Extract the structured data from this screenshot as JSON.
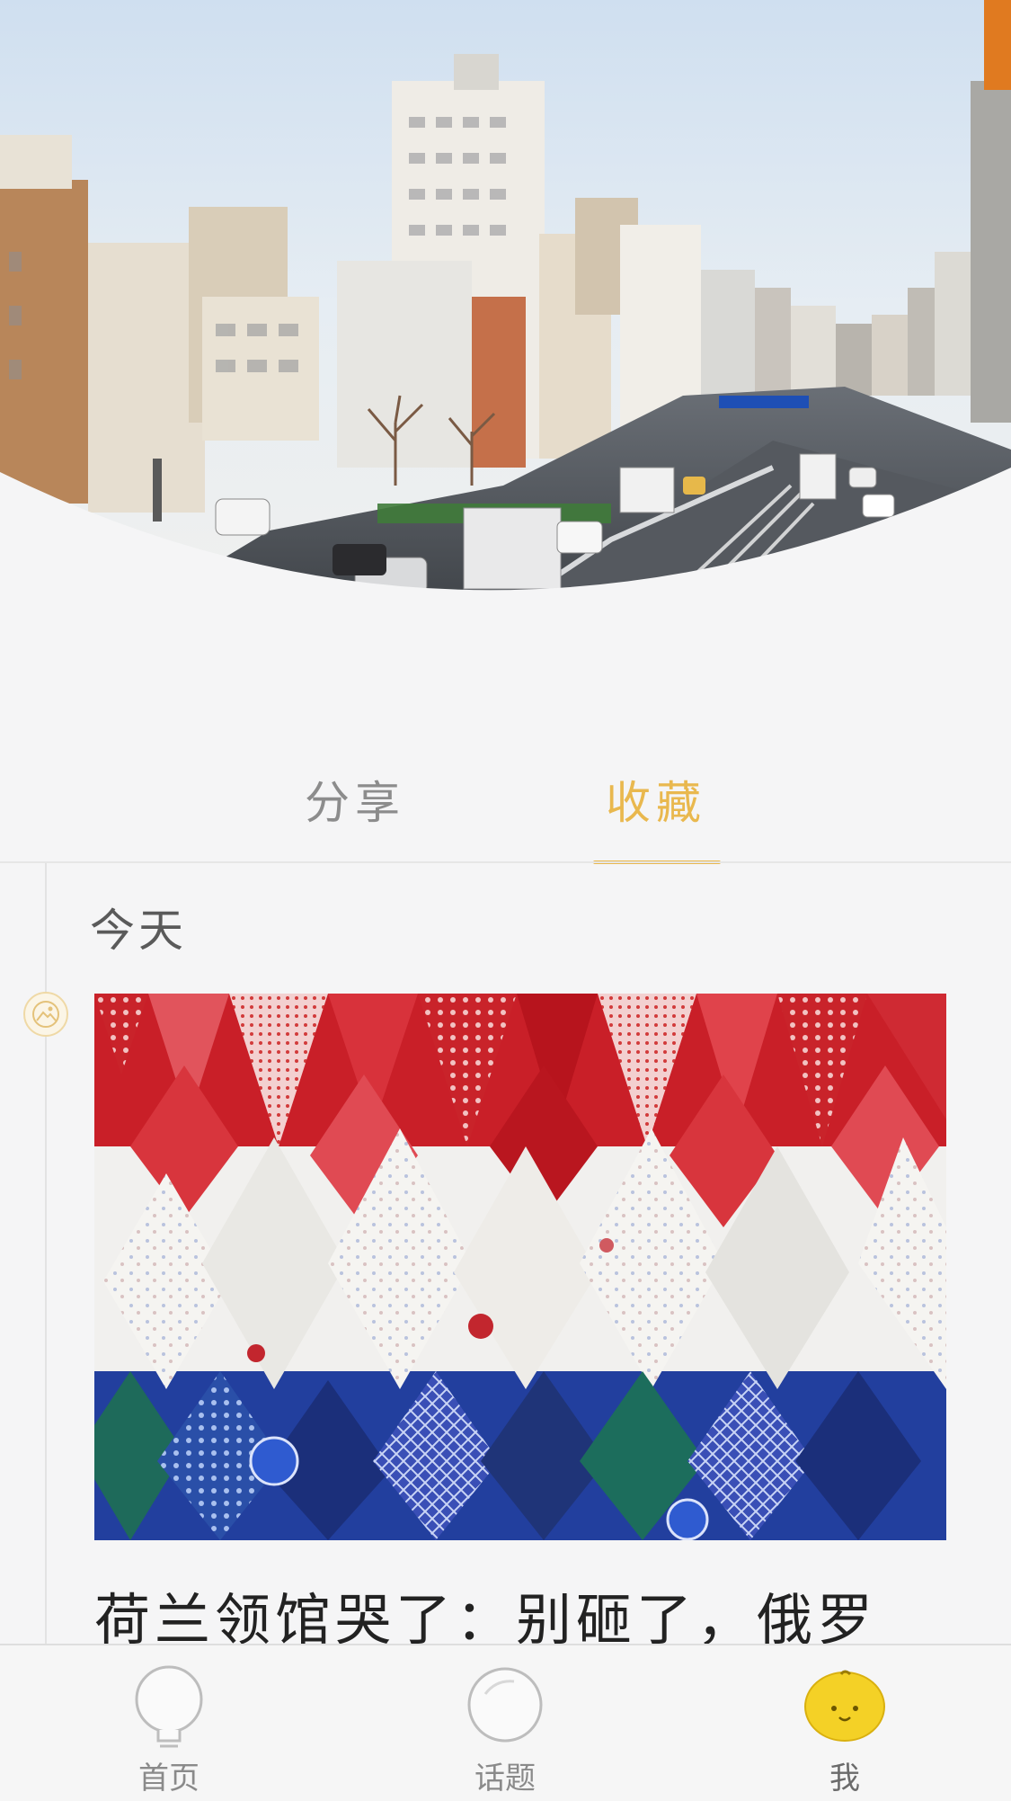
{
  "tabs": [
    {
      "label": "分享",
      "active": false
    },
    {
      "label": "收藏",
      "active": true
    }
  ],
  "colors": {
    "accent": "#e9b84e",
    "inactive_tab": "#8c8c8c",
    "background": "#f5f5f6"
  },
  "timeline": {
    "date_label": "今天",
    "node_icon": "image-icon"
  },
  "post": {
    "image_desc": "patchwork-pattern-image",
    "title": "荷兰领馆哭了：别砸了，俄罗"
  },
  "bottom_nav": [
    {
      "label": "首页",
      "icon": "lightbulb-icon",
      "active": false
    },
    {
      "label": "话题",
      "icon": "bubble-icon",
      "active": false
    },
    {
      "label": "我",
      "icon": "lemon-face-icon",
      "active": true
    }
  ]
}
